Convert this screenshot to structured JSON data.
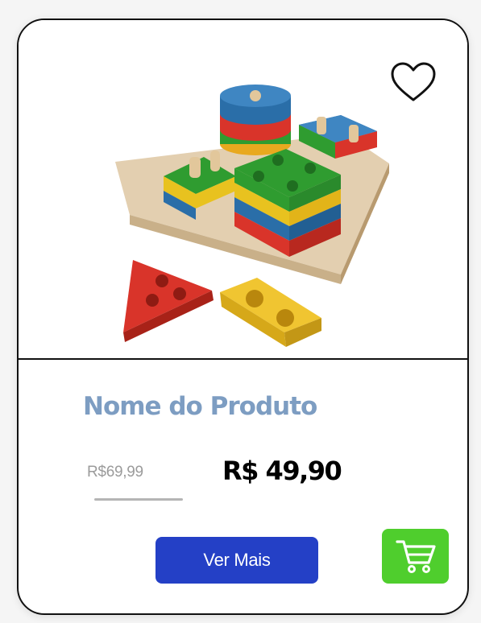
{
  "product": {
    "name": "Nome do Produto",
    "old_price": "R$69,99",
    "price": "R$ 49,90",
    "image_alt": "wooden-shape-sorter-toy"
  },
  "actions": {
    "more_label": "Ver Mais",
    "cart_icon": "cart-icon",
    "favorite_icon": "heart-outline-icon"
  },
  "colors": {
    "name": "#7d9dc2",
    "button": "#2440c6",
    "cart": "#4fce2d",
    "old_price": "#9b9b9b"
  }
}
